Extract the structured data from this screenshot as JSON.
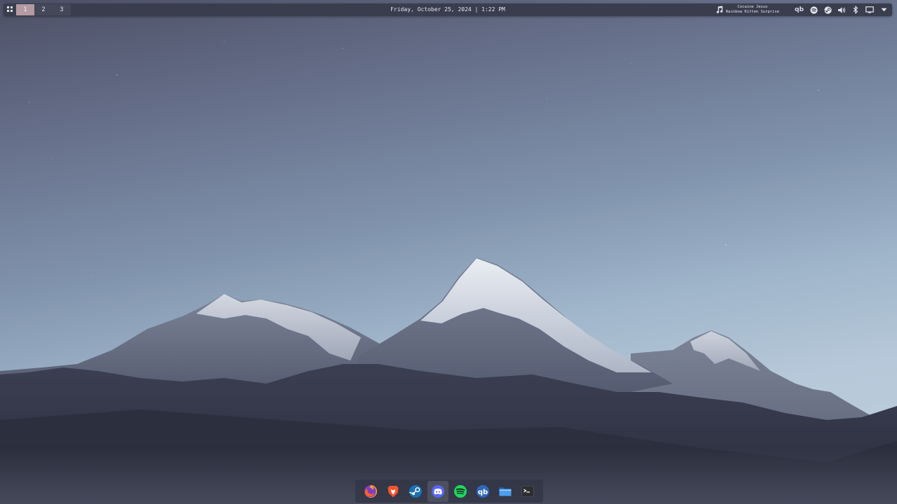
{
  "topbar": {
    "launcher_icon": "grid-icon",
    "workspaces": [
      {
        "label": "1",
        "active": true
      },
      {
        "label": "2",
        "active": false
      },
      {
        "label": "3",
        "active": false
      }
    ],
    "clock": "Friday, October 25, 2024 | 1:22 PM",
    "media": {
      "icon": "music-note-icon",
      "title": "Cocaine Jesus",
      "artist": "Rainbow Kitten Surprise"
    },
    "tray": {
      "qbittorrent_label": "qb",
      "icons": [
        "qbittorrent-icon",
        "spotify-icon",
        "steam-icon",
        "volume-icon",
        "bluetooth-icon",
        "display-icon",
        "chevron-down-icon"
      ]
    }
  },
  "dock": {
    "items": [
      {
        "name": "firefox",
        "icon": "firefox-icon",
        "color": "#ff7139"
      },
      {
        "name": "brave",
        "icon": "brave-icon",
        "color": "#fb542b"
      },
      {
        "name": "steam",
        "icon": "steam-icon",
        "color": "#1b6fb5"
      },
      {
        "name": "discord",
        "icon": "discord-icon",
        "color": "#5865f2",
        "active": true
      },
      {
        "name": "spotify",
        "icon": "spotify-icon",
        "color": "#1ed760"
      },
      {
        "name": "qbittorrent",
        "icon": "qbittorrent-icon",
        "color": "#2f67ba",
        "label": "qb"
      },
      {
        "name": "files",
        "icon": "file-manager-icon",
        "color": "#3d8be0"
      },
      {
        "name": "terminal",
        "icon": "terminal-icon",
        "color": "#3a3a3a"
      }
    ]
  },
  "colors": {
    "bar_background": "#3a3d4d",
    "active_workspace": "#b49aa3",
    "sky_top": "#4c5066",
    "sky_bottom": "#bfcfdd"
  }
}
